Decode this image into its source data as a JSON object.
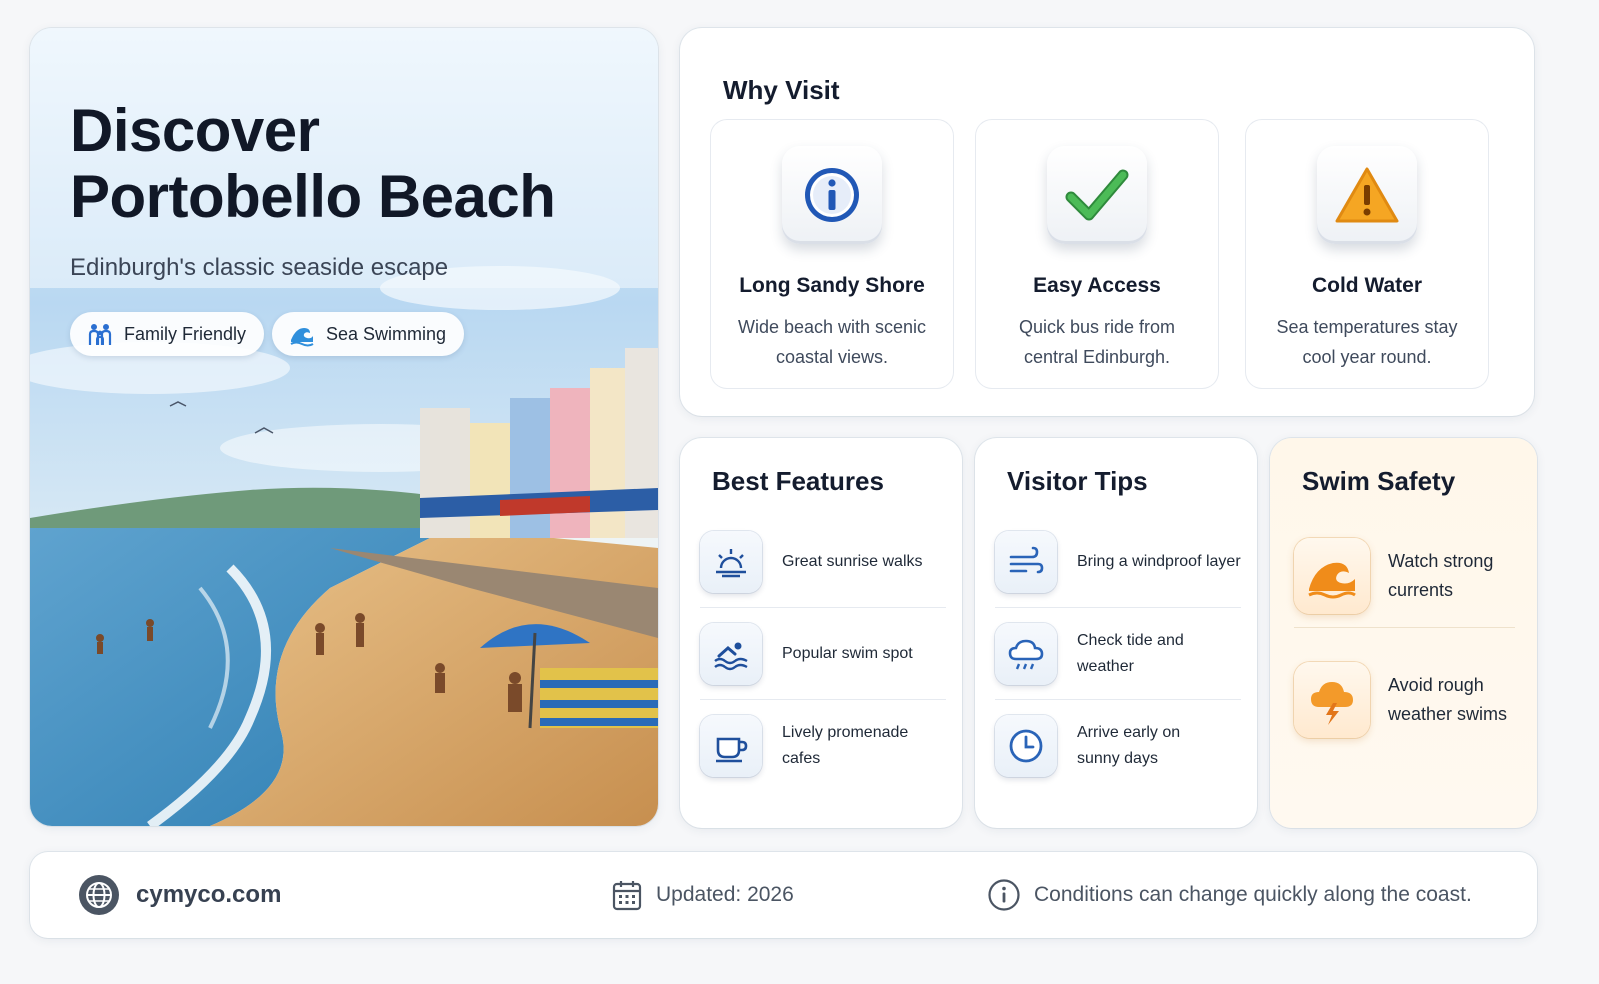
{
  "hero": {
    "title_line1": "Discover",
    "title_line2": "Portobello Beach",
    "subtitle": "Edinburgh's classic seaside escape",
    "tags": [
      {
        "label": "Family Friendly",
        "icon": "family-icon"
      },
      {
        "label": "Sea Swimming",
        "icon": "wave-icon"
      }
    ]
  },
  "why_visit": {
    "title": "Why Visit",
    "items": [
      {
        "title": "Long Sandy Shore",
        "desc": "Wide beach with scenic coastal views.",
        "icon": "info-icon"
      },
      {
        "title": "Easy Access",
        "desc": "Quick bus ride from central Edinburgh.",
        "icon": "checkmark-icon"
      },
      {
        "title": "Cold Water",
        "desc": "Sea temperatures stay cool year round.",
        "icon": "warning-icon"
      }
    ]
  },
  "best_features": {
    "title": "Best Features",
    "items": [
      {
        "label": "Great sunrise walks",
        "icon": "sunrise-icon"
      },
      {
        "label": "Popular swim spot",
        "icon": "swimmer-icon"
      },
      {
        "label": "Lively promenade cafes",
        "icon": "coffee-cup-icon"
      }
    ]
  },
  "visitor_tips": {
    "title": "Visitor Tips",
    "items": [
      {
        "label": "Bring a windproof layer",
        "icon": "wind-icon"
      },
      {
        "label": "Check tide and weather",
        "icon": "rain-cloud-icon"
      },
      {
        "label": "Arrive early on sunny days",
        "icon": "clock-icon"
      }
    ]
  },
  "swim_safety": {
    "title": "Swim Safety",
    "items": [
      {
        "label": "Watch strong currents",
        "icon": "wave-warning-icon"
      },
      {
        "label": "Avoid rough weather swims",
        "icon": "storm-cloud-icon"
      }
    ]
  },
  "footer": {
    "site": "cymyco.com",
    "updated": "Updated: 2026",
    "note": "Conditions can change quickly along the coast."
  },
  "colors": {
    "accent_blue": "#1f5fb8",
    "check_green": "#3aa84a",
    "warning_orange": "#f39a1c",
    "safety_bg": "#fff7ea"
  }
}
